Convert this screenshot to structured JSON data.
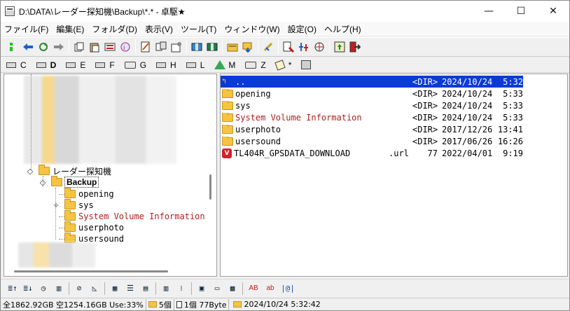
{
  "window": {
    "title": "D:\\DATA\\レーダー探知機\\Backup\\*.* - 卓駆★",
    "minimize": "—",
    "maximize": "☐",
    "close": "✕"
  },
  "menu": [
    "ファイル(F)",
    "編集(E)",
    "フォルダ(D)",
    "表示(V)",
    "ツール(T)",
    "ウィンドウ(W)",
    "設定(O)",
    "ヘルプ(H)"
  ],
  "toolbar_icons": [
    "status-green-icon",
    "back-arrow-icon",
    "refresh-icon",
    "forward-arrow-icon",
    "copy-icon",
    "paste-icon",
    "delete-icon",
    "properties-icon",
    "edit-icon",
    "compare-icon",
    "settings-icon",
    "archive-icon",
    "unarchive-icon",
    "open-folder-icon",
    "move-folder-icon",
    "search-icon",
    "tools-icon",
    "multi-tools-icon",
    "run-icon",
    "exit-icon"
  ],
  "drives": [
    {
      "label": "C",
      "icon": "drive-icon"
    },
    {
      "label": "D",
      "icon": "drive-icon",
      "active": true
    },
    {
      "label": "E",
      "icon": "drive-icon"
    },
    {
      "label": "F",
      "icon": "drive-icon"
    },
    {
      "label": "G",
      "icon": "network-drive-icon"
    },
    {
      "label": "H",
      "icon": "drive-icon"
    },
    {
      "label": "L",
      "icon": "drive-icon"
    },
    {
      "label": "M",
      "icon": "google-drive-icon"
    },
    {
      "label": "Z",
      "icon": "network-drive-icon"
    },
    {
      "label": "*",
      "icon": "pen-icon"
    },
    {
      "label": "",
      "icon": "computer-icon"
    }
  ],
  "tree": {
    "parent": "レーダー探知機",
    "selected": "Backup",
    "children": [
      "opening",
      "sys",
      "System Volume Information",
      "userphoto",
      "usersound"
    ]
  },
  "files": [
    {
      "name": "..",
      "ext": "",
      "size": "<DIR>",
      "date": "2024/10/24",
      "time": "5:32",
      "kind": "updir"
    },
    {
      "name": "opening",
      "ext": "",
      "size": "<DIR>",
      "date": "2024/10/24",
      "time": "5:33",
      "kind": "folder"
    },
    {
      "name": "sys",
      "ext": "",
      "size": "<DIR>",
      "date": "2024/10/24",
      "time": "5:33",
      "kind": "folder"
    },
    {
      "name": "System Volume Information",
      "ext": "",
      "size": "<DIR>",
      "date": "2024/10/24",
      "time": "5:33",
      "kind": "folder-red"
    },
    {
      "name": "userphoto",
      "ext": "",
      "size": "<DIR>",
      "date": "2017/12/26",
      "time": "13:41",
      "kind": "folder"
    },
    {
      "name": "usersound",
      "ext": "",
      "size": "<DIR>",
      "date": "2017/06/26",
      "time": "16:26",
      "kind": "folder"
    },
    {
      "name": "TL404R_GPSDATA_DOWNLOAD",
      "ext": ".url",
      "size": "77",
      "date": "2022/04/01",
      "time": "9:19",
      "kind": "url"
    }
  ],
  "bottom_buttons": [
    "sort-name-icon",
    "sort-ext-icon",
    "sort-time-icon",
    "sort-size-icon",
    "filter-icon",
    "unfilter-icon",
    "view-large-icon",
    "view-list-icon",
    "view-details-icon",
    "view-a-icon",
    "view-b-icon",
    "tab-icon",
    "folder-bar-icon",
    "color-icon"
  ],
  "bottom_text_buttons": [
    "AB",
    "ab",
    "|@|"
  ],
  "status": {
    "disk": "全1862.92GB 空1254.16GB Use:33%",
    "count": "5個",
    "files": "1個 77Byte",
    "date": "2024/10/24 5:32:42"
  }
}
